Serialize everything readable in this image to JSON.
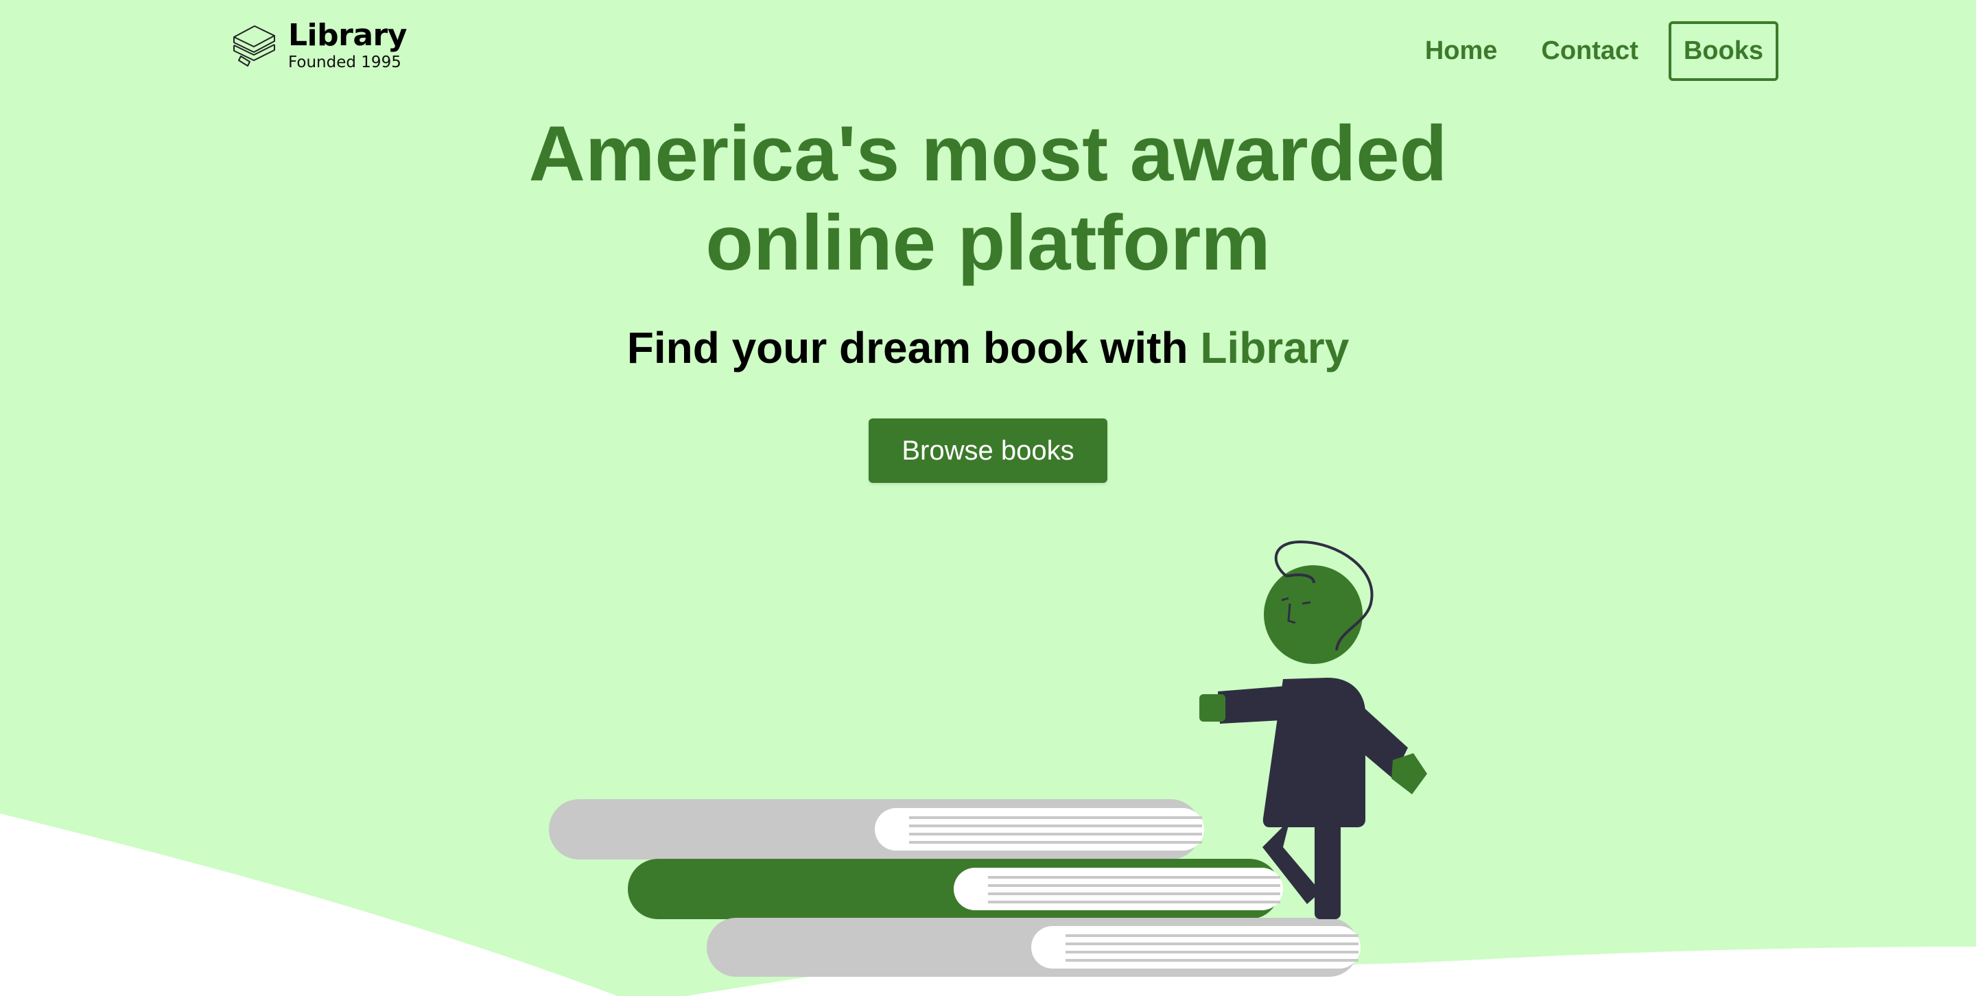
{
  "brand": {
    "title": "Library",
    "subtitle": "Founded 1995",
    "logo_icon": "stacked-books-icon"
  },
  "nav": {
    "items": [
      {
        "label": "Home"
      },
      {
        "label": "Contact"
      },
      {
        "label": "Books"
      }
    ]
  },
  "hero": {
    "title_line1": "America's most awarded",
    "title_line2": "online platform",
    "subtitle_prefix": "Find your dream book with ",
    "subtitle_accent": "Library",
    "cta_label": "Browse books"
  },
  "colors": {
    "background": "#cdfcc5",
    "accent": "#3c7a2b",
    "dark": "#2f2e41",
    "book_gray": "#c8c8c8",
    "white": "#ffffff"
  }
}
